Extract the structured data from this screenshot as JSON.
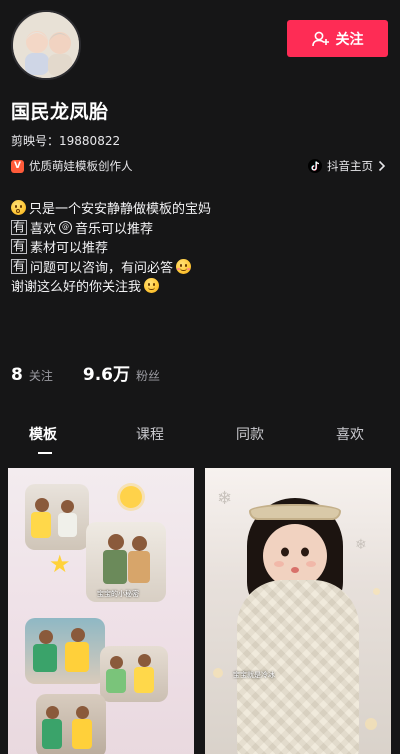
{
  "profile": {
    "nickname": "国民龙凤胎",
    "capcut_id_label": "剪映号：",
    "capcut_id": "19880822",
    "creator_badge": "V",
    "creator_label": "优质萌娃模板创作人",
    "douyin_link_label": "抖音主页"
  },
  "follow_button": {
    "label": "关注"
  },
  "bio": {
    "line1": "只是一个安安静静做模板的宝妈",
    "line2_box": "有",
    "line2_a": "喜欢",
    "line2_at": "@",
    "line2_b": "音乐可以推荐",
    "line3_box": "有",
    "line3": "素材可以推荐",
    "line4_box": "有",
    "line4": "问题可以咨询，有问必答",
    "line5": "谢谢这么好的你关注我"
  },
  "stats": {
    "following_count": "8",
    "following_label": "关注",
    "followers_count": "9.6万",
    "followers_label": "粉丝"
  },
  "tabs": [
    {
      "label": "模板",
      "active": true
    },
    {
      "label": "课程",
      "active": false
    },
    {
      "label": "同款",
      "active": false
    },
    {
      "label": "喜欢",
      "active": false
    }
  ],
  "cards": [
    {
      "caption": "宝宝的小秘密"
    },
    {
      "caption": "宝宝就是冷冰"
    }
  ],
  "colors": {
    "background": "#161617",
    "follow_button": "#fe2c55",
    "creator_badge": "#ff5b3a"
  }
}
